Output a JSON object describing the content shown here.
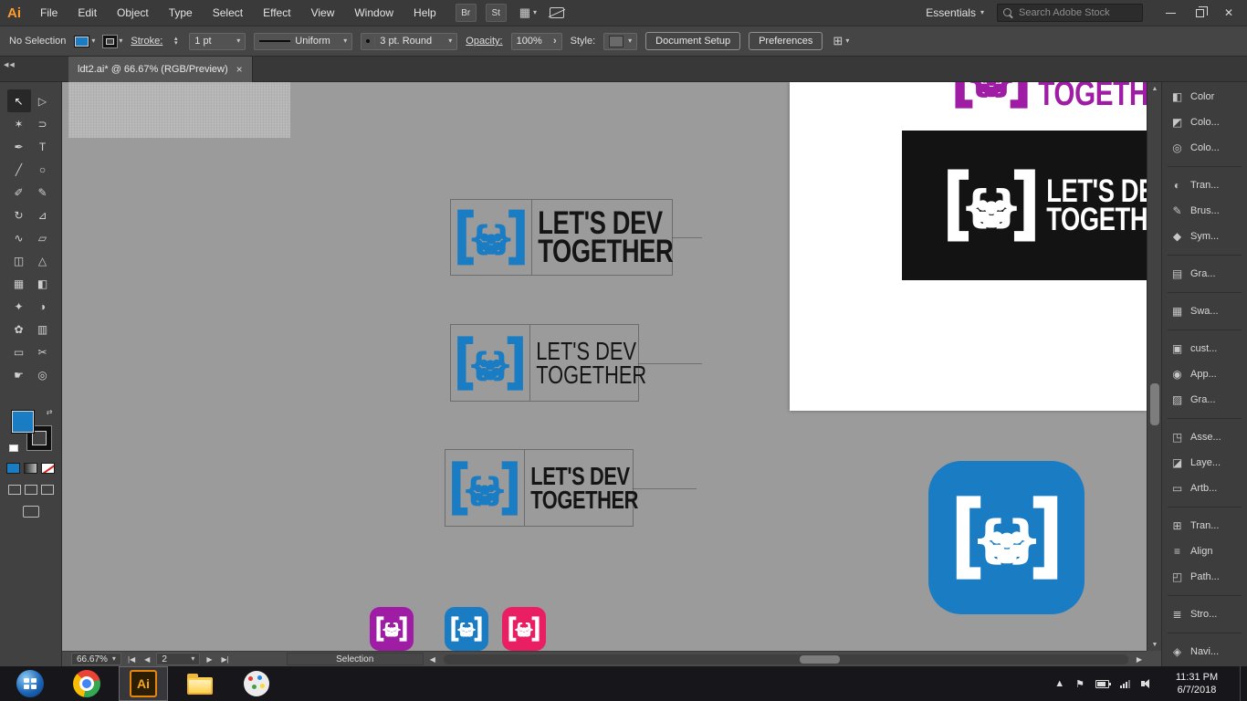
{
  "colors": {
    "accent_blue": "#1a7dc4",
    "purple": "#9e1da4",
    "pink": "#ea1f63"
  },
  "titlebar": {
    "app_logo": "Ai",
    "menus": [
      "File",
      "Edit",
      "Object",
      "Type",
      "Select",
      "Effect",
      "View",
      "Window",
      "Help"
    ],
    "bridge_button": "Br",
    "stock_button": "St",
    "workspace": "Essentials",
    "search_placeholder": "Search Adobe Stock"
  },
  "controlbar": {
    "selection_status": "No Selection",
    "stroke_label": "Stroke:",
    "stroke_value": "1 pt",
    "profile_value": "Uniform",
    "brush_value": "3 pt. Round",
    "opacity_label": "Opacity:",
    "opacity_value": "100%",
    "style_label": "Style:",
    "document_setup_button": "Document Setup",
    "preferences_button": "Preferences"
  },
  "tabbar": {
    "document_title": "ldt2.ai* @ 66.67% (RGB/Preview)"
  },
  "tools": [
    {
      "name": "selection",
      "glyph": "↖"
    },
    {
      "name": "direct-selection",
      "glyph": "▷"
    },
    {
      "name": "magic-wand",
      "glyph": "✶"
    },
    {
      "name": "lasso",
      "glyph": "⊃"
    },
    {
      "name": "pen",
      "glyph": "✒"
    },
    {
      "name": "type",
      "glyph": "T"
    },
    {
      "name": "line-segment",
      "glyph": "╱"
    },
    {
      "name": "ellipse",
      "glyph": "○"
    },
    {
      "name": "paintbrush",
      "glyph": "✐"
    },
    {
      "name": "pencil",
      "glyph": "✎"
    },
    {
      "name": "rotate",
      "glyph": "↻"
    },
    {
      "name": "scale",
      "glyph": "⊿"
    },
    {
      "name": "width",
      "glyph": "∿"
    },
    {
      "name": "free-transform",
      "glyph": "▱"
    },
    {
      "name": "shape-builder",
      "glyph": "◫"
    },
    {
      "name": "perspective-grid",
      "glyph": "△"
    },
    {
      "name": "mesh",
      "glyph": "▦"
    },
    {
      "name": "gradient",
      "glyph": "◧"
    },
    {
      "name": "eyedropper",
      "glyph": "✦"
    },
    {
      "name": "blend",
      "glyph": "◑"
    },
    {
      "name": "symbol-sprayer",
      "glyph": "✿"
    },
    {
      "name": "column-graph",
      "glyph": "▥"
    },
    {
      "name": "artboard",
      "glyph": "▭"
    },
    {
      "name": "slice",
      "glyph": "✂"
    },
    {
      "name": "hand",
      "glyph": "☛"
    },
    {
      "name": "zoom",
      "glyph": "◎"
    }
  ],
  "artwork": {
    "line1": "LET'S DEV",
    "line2": "TOGETHER"
  },
  "panels": [
    {
      "icon": "◧",
      "label": "Color"
    },
    {
      "icon": "◩",
      "label": "Colo..."
    },
    {
      "icon": "◎",
      "label": "Colo..."
    },
    {
      "icon": "◐",
      "label": "Tran..."
    },
    {
      "icon": "✎",
      "label": "Brus..."
    },
    {
      "icon": "◆",
      "label": "Sym..."
    },
    {
      "icon": "▤",
      "label": "Gra..."
    },
    {
      "icon": "▦",
      "label": "Swa..."
    },
    {
      "icon": "▣",
      "label": "cust..."
    },
    {
      "icon": "◉",
      "label": "App..."
    },
    {
      "icon": "▨",
      "label": "Gra..."
    },
    {
      "icon": "◳",
      "label": "Asse..."
    },
    {
      "icon": "◪",
      "label": "Laye..."
    },
    {
      "icon": "▭",
      "label": "Artb..."
    },
    {
      "icon": "⊞",
      "label": "Tran..."
    },
    {
      "icon": "≡",
      "label": "Align"
    },
    {
      "icon": "◰",
      "label": "Path..."
    },
    {
      "icon": "≣",
      "label": "Stro..."
    },
    {
      "icon": "◈",
      "label": "Navi..."
    }
  ],
  "statusbar": {
    "zoom": "66.67%",
    "artboard_number": "2",
    "status_field": "Selection"
  },
  "taskbar": {
    "time": "11:31 PM",
    "date": "6/7/2018"
  },
  "icons": {
    "chevron_down": "▾",
    "collapse": "◀◀",
    "close_window": "✕",
    "tab_close": "×",
    "scroll_up": "▲",
    "scroll_down": "▼",
    "scroll_left": "◀",
    "scroll_right": "▶",
    "nav_first": "|◀",
    "nav_prev": "◀",
    "nav_next": "▶",
    "nav_last": "▶|",
    "flyout": "›",
    "tray_chevron": "▲",
    "tray_flag": "⚑",
    "stepper_up": "▴",
    "stepper_down": "▾",
    "arrange": "▦",
    "grid": "⊞"
  }
}
